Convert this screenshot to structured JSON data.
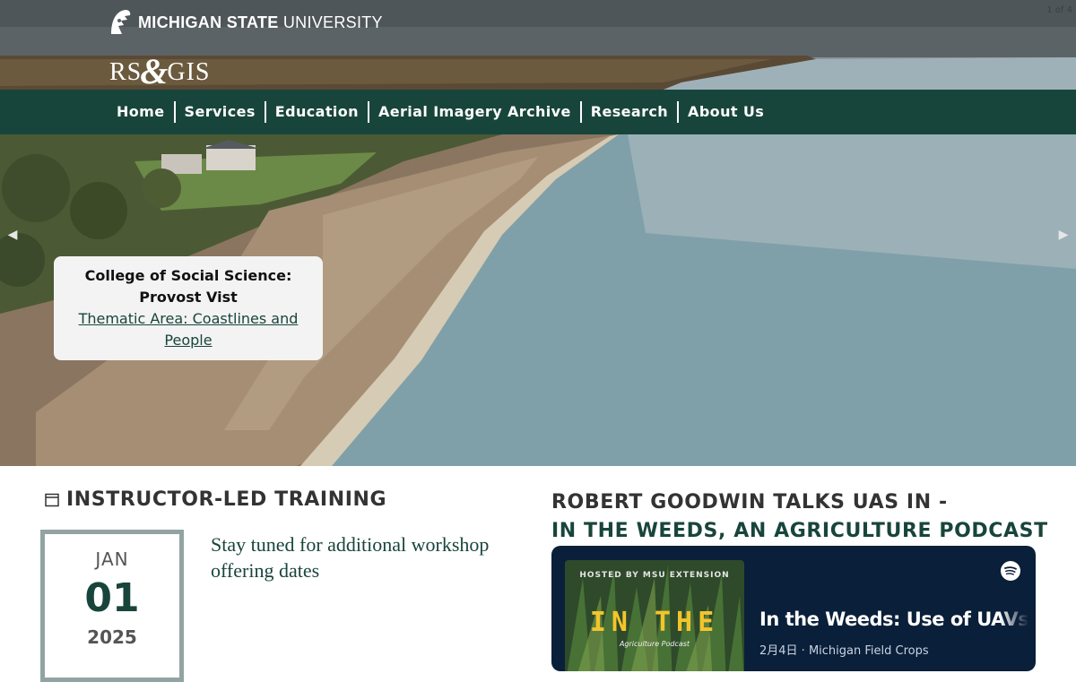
{
  "site": {
    "university_bold": "MICHIGAN STATE",
    "university_light": "UNIVERSITY",
    "logo_left": "RS",
    "logo_amp": "&",
    "logo_right": "GIS"
  },
  "nav": {
    "items": [
      {
        "label": "Home"
      },
      {
        "label": "Services"
      },
      {
        "label": "Education"
      },
      {
        "label": "Aerial Imagery Archive"
      },
      {
        "label": "Research"
      },
      {
        "label": "About Us"
      }
    ]
  },
  "slider": {
    "counter": "1 of 4",
    "prev_icon": "chevron-left-icon",
    "next_icon": "chevron-right-icon",
    "caption_title": "College of Social Science: Provost Vist",
    "caption_link": "Thematic Area: Coastlines and People"
  },
  "training": {
    "heading": "INSTRUCTOR-LED TRAINING",
    "icon": "calendar-icon",
    "month": "JAN",
    "day": "01",
    "year": "2025",
    "text": "Stay tuned for additional workshop offering dates"
  },
  "podcast": {
    "heading_line1": "ROBERT GOODWIN TALKS UAS IN -",
    "heading_line2": "IN THE WEEDS, AN AGRICULTURE PODCAST",
    "cover_hosted": "HOSTED BY MSU EXTENSION",
    "cover_big": "IN THE",
    "cover_sub": "Agriculture Podcast",
    "episode_title": "In the Weeds: Use of UAVs",
    "episode_meta": "2月4日 · Michigan Field Crops",
    "spotify_icon": "spotify-icon"
  },
  "colors": {
    "msu_green": "#18453b",
    "player_bg": "#0a1f39",
    "date_border": "#91a4a2"
  }
}
